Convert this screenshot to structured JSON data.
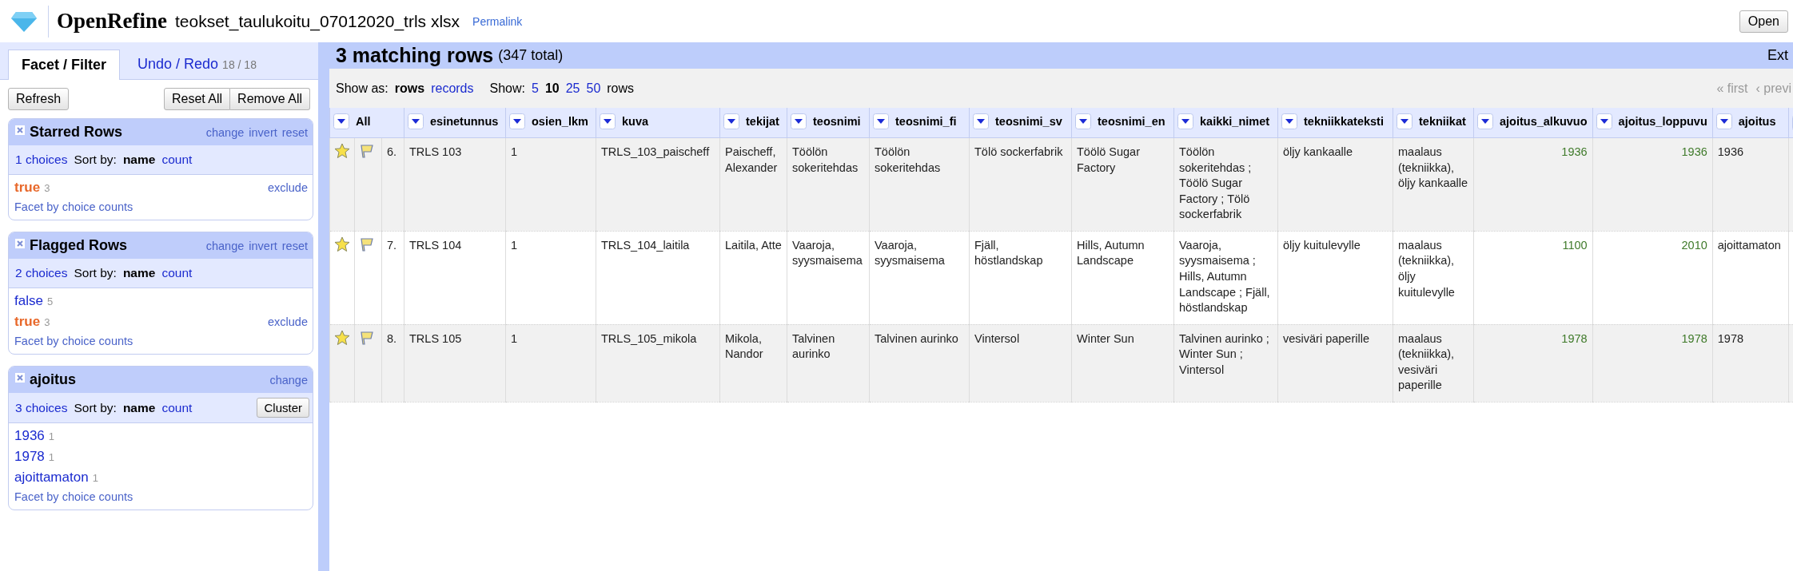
{
  "header": {
    "app_name": "OpenRefine",
    "project_name": "teokset_taulukoitu_07012020_trls xlsx",
    "permalink": "Permalink",
    "open_button": "Open"
  },
  "left_tabs": [
    {
      "label": "Facet / Filter",
      "selected": true
    },
    {
      "label": "Undo / Redo",
      "count": "18 / 18",
      "selected": false
    }
  ],
  "left_buttons": {
    "refresh": "Refresh",
    "reset_all": "Reset All",
    "remove_all": "Remove All"
  },
  "facets": [
    {
      "title": "Starred Rows",
      "actions": [
        "change",
        "invert",
        "reset"
      ],
      "choices_count": "1 choices",
      "sort_label": "Sort by:",
      "sort_options": [
        {
          "label": "name",
          "selected": true
        },
        {
          "label": "count",
          "selected": false
        }
      ],
      "choices": [
        {
          "name": "true",
          "count": "3",
          "selected": true,
          "exclude": "exclude"
        }
      ],
      "footer": "Facet by choice counts"
    },
    {
      "title": "Flagged Rows",
      "actions": [
        "change",
        "invert",
        "reset"
      ],
      "choices_count": "2 choices",
      "sort_label": "Sort by:",
      "sort_options": [
        {
          "label": "name",
          "selected": true
        },
        {
          "label": "count",
          "selected": false
        }
      ],
      "choices": [
        {
          "name": "false",
          "count": "5",
          "selected": false
        },
        {
          "name": "true",
          "count": "3",
          "selected": true,
          "exclude": "exclude"
        }
      ],
      "footer": "Facet by choice counts"
    },
    {
      "title": "ajoitus",
      "actions": [
        "change"
      ],
      "cluster_button": "Cluster",
      "choices_count": "3 choices",
      "sort_label": "Sort by:",
      "sort_options": [
        {
          "label": "name",
          "selected": true
        },
        {
          "label": "count",
          "selected": false
        }
      ],
      "choices": [
        {
          "name": "1936",
          "count": "1",
          "selected": false
        },
        {
          "name": "1978",
          "count": "1",
          "selected": false
        },
        {
          "name": "ajoittamaton",
          "count": "1",
          "selected": false
        }
      ],
      "footer": "Facet by choice counts"
    }
  ],
  "summary": {
    "matching": "3 matching rows",
    "total": "(347 total)",
    "extensions": "Ext"
  },
  "view_bar": {
    "show_as_label": "Show as:",
    "show_as": [
      {
        "label": "rows",
        "selected": true
      },
      {
        "label": "records",
        "selected": false
      }
    ],
    "show_label": "Show:",
    "page_sizes": [
      {
        "label": "5",
        "selected": false
      },
      {
        "label": "10",
        "selected": true
      },
      {
        "label": "25",
        "selected": false
      },
      {
        "label": "50",
        "selected": false
      }
    ],
    "rows_label": "rows",
    "pager": [
      "« first",
      "‹ previ"
    ]
  },
  "table": {
    "all_label": "All",
    "columns": [
      {
        "name": "esinetunnus",
        "kind": "text"
      },
      {
        "name": "osien_lkm",
        "kind": "text"
      },
      {
        "name": "kuva",
        "kind": "text"
      },
      {
        "name": "tekijat",
        "kind": "text"
      },
      {
        "name": "teosnimi",
        "kind": "text"
      },
      {
        "name": "teosnimi_fi",
        "kind": "text"
      },
      {
        "name": "teosnimi_sv",
        "kind": "text"
      },
      {
        "name": "teosnimi_en",
        "kind": "text"
      },
      {
        "name": "kaikki_nimet",
        "kind": "text"
      },
      {
        "name": "tekniikkateksti",
        "kind": "text"
      },
      {
        "name": "tekniikat",
        "kind": "text"
      },
      {
        "name": "ajoitus_alkuvuo",
        "kind": "number"
      },
      {
        "name": "ajoitus_loppuvu",
        "kind": "number"
      },
      {
        "name": "ajoitus",
        "kind": "text"
      }
    ],
    "rows": [
      {
        "starred": true,
        "flagged": true,
        "index": "6.",
        "cells": [
          "TRLS 103",
          "1",
          "TRLS_103_paischeff",
          "Paischeff, Alexander",
          "Töölön sokeritehdas",
          "Töölön sokeritehdas",
          "Tölö sockerfabrik",
          "Töölö Sugar Factory",
          "Töölön sokeritehdas ; Töölö Sugar Factory ;  Tölö sockerfabrik",
          "öljy kankaalle",
          "maalaus (tekniikka), öljy kankaalle",
          "1936",
          "1936",
          "1936"
        ]
      },
      {
        "starred": true,
        "flagged": true,
        "index": "7.",
        "cells": [
          "TRLS 104",
          "1",
          "TRLS_104_laitila",
          "Laitila, Atte",
          "Vaaroja, syysmaisema",
          "Vaaroja, syysmaisema",
          "Fjäll, höstlandskap",
          "Hills, Autumn Landscape",
          "Vaaroja, syysmaisema ; Hills, Autumn Landscape ; Fjäll, höstlandskap",
          "öljy kuitulevylle",
          "maalaus (tekniikka), öljy kuitulevylle",
          "1100",
          "2010",
          "ajoittamaton"
        ]
      },
      {
        "starred": true,
        "flagged": true,
        "index": "8.",
        "cells": [
          "TRLS 105",
          "1",
          "TRLS_105_mikola",
          "Mikola, Nandor",
          "Talvinen aurinko",
          "Talvinen aurinko",
          "Vintersol",
          "Winter Sun",
          "Talvinen aurinko ; Winter Sun ; Vintersol",
          "vesiväri paperille",
          "maalaus (tekniikka), vesiväri paperille",
          "1978",
          "1978",
          "1978"
        ]
      }
    ]
  }
}
